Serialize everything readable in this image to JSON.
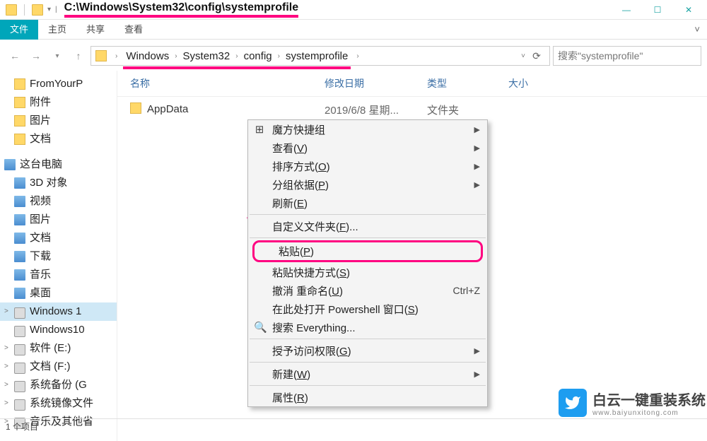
{
  "title_path": "C:\\Windows\\System32\\config\\systemprofile",
  "window_buttons": {
    "min": "—",
    "max": "☐",
    "close": "✕"
  },
  "ribbon": {
    "file": "文件",
    "home": "主页",
    "share": "共享",
    "view": "查看"
  },
  "breadcrumbs": [
    "Windows",
    "System32",
    "config",
    "systemprofile"
  ],
  "search_placeholder": "搜索\"systemprofile\"",
  "nav_items": [
    {
      "label": "FromYourP",
      "icon": "yfolder"
    },
    {
      "label": "附件",
      "icon": "yfolder"
    },
    {
      "label": "图片",
      "icon": "yfolder"
    },
    {
      "label": "文档",
      "icon": "yfolder"
    },
    {
      "label": "这台电脑",
      "icon": "pc",
      "caret": "˅",
      "header": true
    },
    {
      "label": "3D 对象",
      "icon": "pc"
    },
    {
      "label": "视频",
      "icon": "pc"
    },
    {
      "label": "图片",
      "icon": "pc"
    },
    {
      "label": "文档",
      "icon": "pc"
    },
    {
      "label": "下载",
      "icon": "pc"
    },
    {
      "label": "音乐",
      "icon": "pc"
    },
    {
      "label": "桌面",
      "icon": "pc"
    },
    {
      "label": "Windows 1",
      "icon": "disk",
      "caret": "˃",
      "selected": true
    },
    {
      "label": "Windows10",
      "icon": "disk"
    },
    {
      "label": "软件 (E:)",
      "icon": "disk",
      "caret": "˃"
    },
    {
      "label": "文档 (F:)",
      "icon": "disk",
      "caret": "˃"
    },
    {
      "label": "系统备份 (G",
      "icon": "disk",
      "caret": "˃"
    },
    {
      "label": "系统镜像文件",
      "icon": "disk",
      "caret": "˃"
    },
    {
      "label": "音乐及其他省",
      "icon": "disk",
      "caret": "˃"
    }
  ],
  "columns": {
    "name": "名称",
    "date": "修改日期",
    "type": "类型",
    "size": "大小"
  },
  "rows": [
    {
      "name": "AppData",
      "date": "2019/6/8 星期...",
      "type": "文件夹",
      "size": ""
    }
  ],
  "context_menu": [
    {
      "label": "魔方快捷组",
      "icon": "⊞",
      "submenu": true
    },
    {
      "label": "查看(",
      "u": "V",
      "after": ")",
      "submenu": true
    },
    {
      "label": "排序方式(",
      "u": "O",
      "after": ")",
      "submenu": true
    },
    {
      "label": "分组依据(",
      "u": "P",
      "after": ")",
      "submenu": true
    },
    {
      "label": "刷新(",
      "u": "E",
      "after": ")"
    },
    {
      "sep": true
    },
    {
      "label": "自定义文件夹(",
      "u": "F",
      "after": ")..."
    },
    {
      "sep": true
    },
    {
      "label": "粘贴(",
      "u": "P",
      "after": ")",
      "highlight": true
    },
    {
      "label": "粘贴快捷方式(",
      "u": "S",
      "after": ")"
    },
    {
      "label": "撤消 重命名(",
      "u": "U",
      "after": ")",
      "shortcut": "Ctrl+Z"
    },
    {
      "label": "在此处打开 Powershell 窗口(",
      "u": "S",
      "after": ")"
    },
    {
      "label": "搜索 Everything...",
      "icon": "🔍"
    },
    {
      "sep": true
    },
    {
      "label": "授予访问权限(",
      "u": "G",
      "after": ")",
      "submenu": true
    },
    {
      "sep": true
    },
    {
      "label": "新建(",
      "u": "W",
      "after": ")",
      "submenu": true
    },
    {
      "sep": true
    },
    {
      "label": "属性(",
      "u": "R",
      "after": ")"
    }
  ],
  "status": "1 个项目",
  "brand": {
    "line1": "白云一键重装系统",
    "line2": "www.baiyunxitong.com"
  }
}
